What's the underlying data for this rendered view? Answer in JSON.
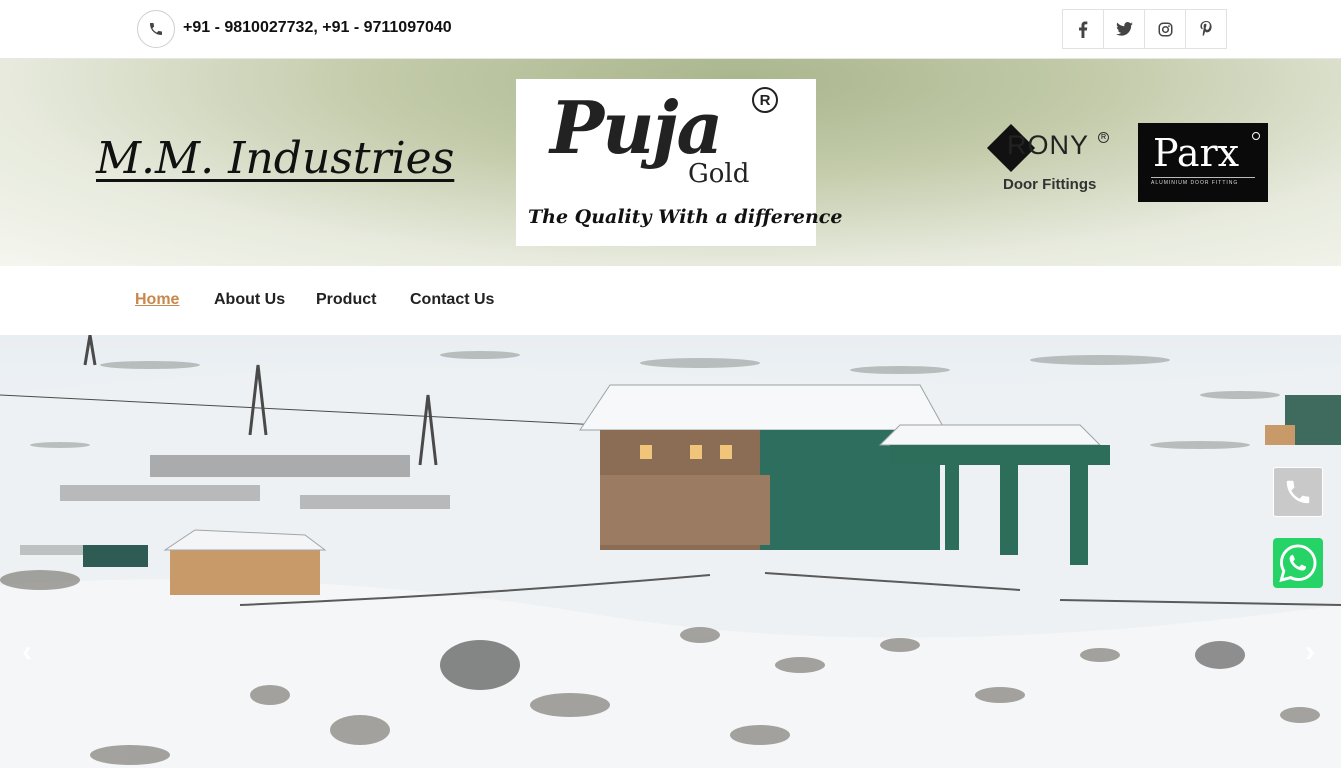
{
  "topbar": {
    "phones": "+91 - 9810027732,  +91 - 9711097040",
    "social": [
      {
        "name": "facebook-icon",
        "glyph": "f"
      },
      {
        "name": "twitter-icon",
        "glyph": "t"
      },
      {
        "name": "instagram-icon",
        "glyph": "◎"
      },
      {
        "name": "pinterest-icon",
        "glyph": "p"
      }
    ]
  },
  "header": {
    "company_name": "M.M. Industries",
    "logo": {
      "brand": "Puja",
      "sub": "Gold",
      "reg": "R",
      "tagline": "The Quality With a difference"
    },
    "partner1": {
      "name": "RONY",
      "sub": "Door Fittings",
      "reg": "R"
    },
    "partner2": {
      "name": "Parx",
      "sub": "ALUMINIUM DOOR FITTING"
    }
  },
  "nav": {
    "items": [
      "Home",
      "About Us",
      "Product",
      "Contact Us"
    ],
    "active": "Home"
  },
  "hero": {
    "prev_arrow": "‹",
    "next_arrow": "›"
  },
  "colors": {
    "accent": "#c9874a",
    "whatsapp": "#25d366"
  }
}
